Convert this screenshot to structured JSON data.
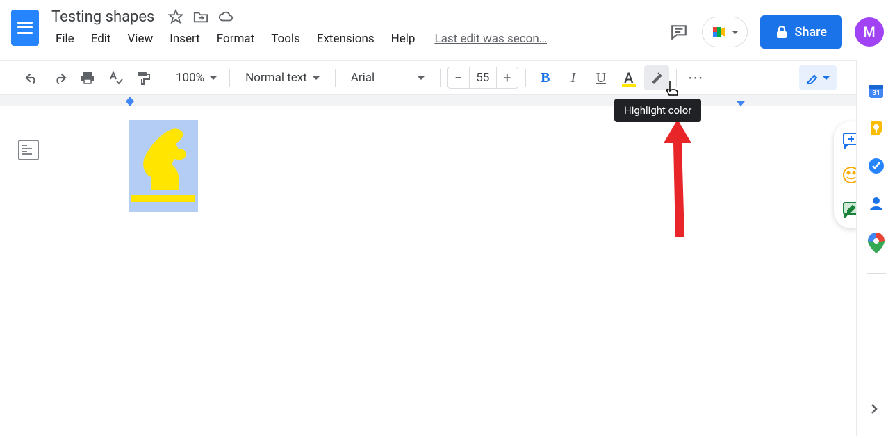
{
  "header": {
    "title": "Testing shapes",
    "last_edit": "Last edit was secon…",
    "share_label": "Share",
    "avatar_initial": "M"
  },
  "menu": {
    "file": "File",
    "edit": "Edit",
    "view": "View",
    "insert": "Insert",
    "format": "Format",
    "tools": "Tools",
    "extensions": "Extensions",
    "help": "Help"
  },
  "toolbar": {
    "zoom": "100%",
    "paragraph_style": "Normal text",
    "font_family": "Arial",
    "font_size": "55",
    "minus": "−",
    "plus": "+",
    "bold": "B",
    "italic": "I",
    "underline": "U",
    "text_color_glyph": "A",
    "more": "⋯"
  },
  "tooltip": {
    "highlight_color": "Highlight color"
  },
  "side_panel": {
    "calendar_day": "31"
  }
}
